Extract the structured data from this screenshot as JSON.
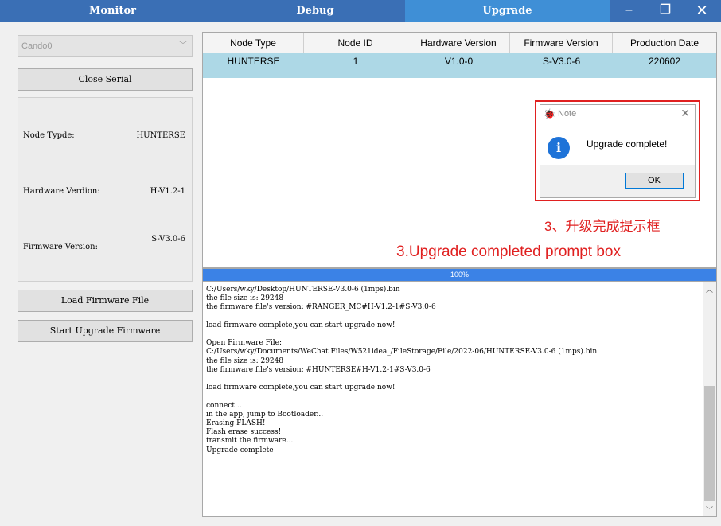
{
  "tabs": {
    "monitor": "Monitor",
    "debug": "Debug",
    "upgrade": "Upgrade"
  },
  "window_controls": {
    "minimize": "–",
    "maximize": "❐",
    "close": "✕"
  },
  "left_panel": {
    "can_select": "Cando0",
    "close_serial_label": "Close Serial",
    "node_type_label": "Node Typde:",
    "node_type_value": "HUNTERSE",
    "hardware_label": "Hardware Verdion:",
    "hardware_value": "H-V1.2-1",
    "firmware_label": "Firmware Version:",
    "firmware_value": "S-V3.0-6",
    "load_firmware_label": "Load Firmware File",
    "start_upgrade_label": "Start Upgrade Firmware"
  },
  "table": {
    "headers": [
      "Node Type",
      "Node ID",
      "Hardware Version",
      "Firmware Version",
      "Production Date"
    ],
    "rows": [
      [
        "HUNTERSE",
        "1",
        "V1.0-0",
        "S-V3.0-6",
        "220602"
      ]
    ]
  },
  "progress": {
    "value": 100,
    "label": "100%"
  },
  "log_lines": [
    "C:/Users/wky/Desktop/HUNTERSE-V3.0-6 (1mps).bin",
    "the file size is: 29248",
    "the firmware file's version: #RANGER_MC#H-V1.2-1#S-V3.0-6",
    "",
    "load firmware complete,you can start upgrade now!",
    "",
    "Open Firmware File:",
    "C:/Users/wky/Documents/WeChat Files/W521idea_/FileStorage/File/2022-06/HUNTERSE-V3.0-6 (1mps).bin",
    "the file size is: 29248",
    "the firmware file's version: #HUNTERSE#H-V1.2-1#S-V3.0-6",
    "",
    "load firmware complete,you can start upgrade now!",
    "",
    "connect...",
    "in the app, jump to Bootloader...",
    "Erasing FLASH!",
    "Flash erase success!",
    "transmit the firmware...",
    "Upgrade complete"
  ],
  "dialog": {
    "title": "Note",
    "message": "Upgrade complete!",
    "ok_label": "OK"
  },
  "annotations": {
    "zh": "3、升级完成提示框",
    "en": "3.Upgrade completed prompt box"
  }
}
